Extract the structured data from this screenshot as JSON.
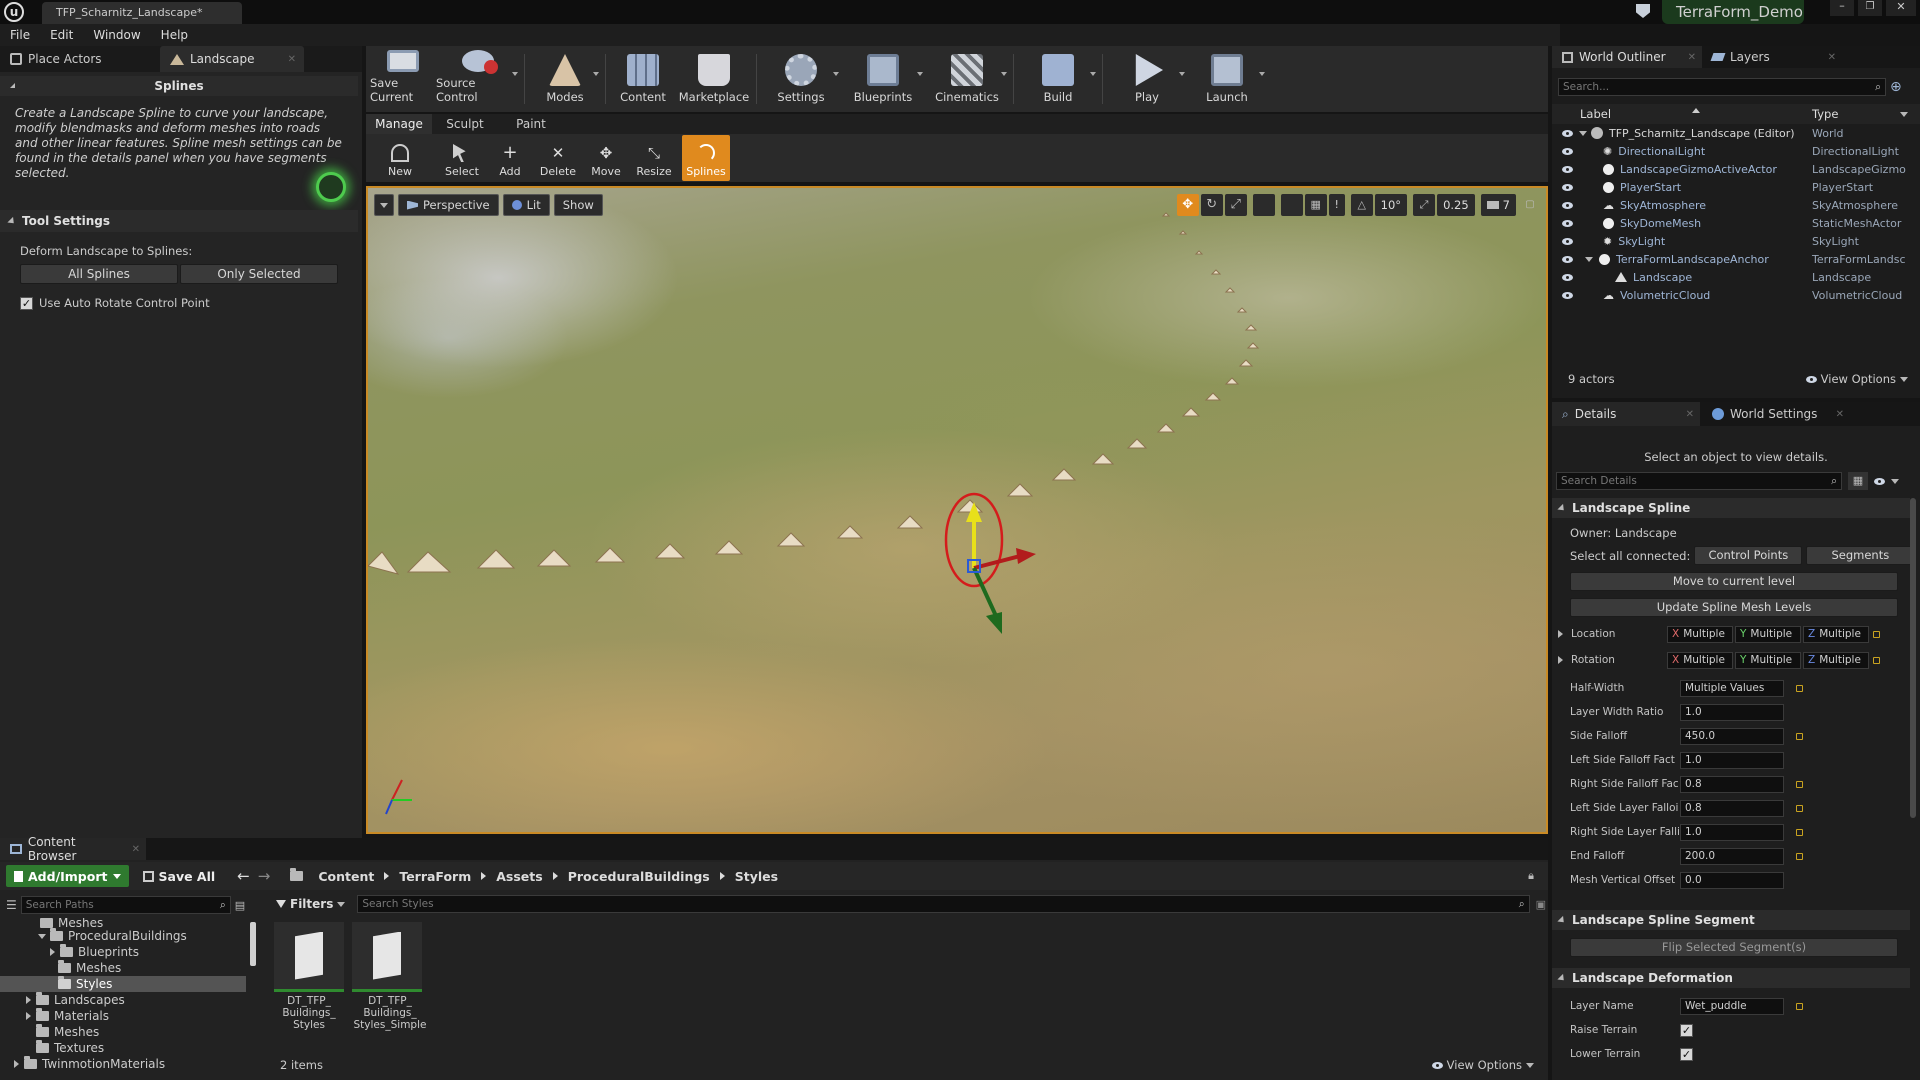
{
  "window": {
    "tab_title": "TFP_Scharnitz_Landscape*",
    "project_name": "TerraForm_Demo"
  },
  "menu": [
    "File",
    "Edit",
    "Window",
    "Help"
  ],
  "left_tabs": {
    "place_actors": "Place Actors",
    "landscape": "Landscape"
  },
  "splines_panel": {
    "title": "Splines",
    "description": "Create a Landscape Spline to curve your landscape, modify blendmasks and deform meshes into roads and other linear features.  Spline mesh settings can be found in the details panel when you have  segments selected.",
    "tool_settings_title": "Tool Settings",
    "deform_label": "Deform Landscape to Splines:",
    "all_splines": "All Splines",
    "only_selected": "Only Selected",
    "auto_rotate_label": "Use Auto Rotate Control Point",
    "auto_rotate_checked": true
  },
  "toolbar": [
    {
      "label": "Save Current",
      "icon": "save-icon"
    },
    {
      "label": "Source Control",
      "icon": "source-control-icon"
    },
    {
      "label": "Modes",
      "icon": "modes-icon"
    },
    {
      "label": "Content",
      "icon": "content-icon"
    },
    {
      "label": "Marketplace",
      "icon": "marketplace-icon"
    },
    {
      "label": "Settings",
      "icon": "settings-icon"
    },
    {
      "label": "Blueprints",
      "icon": "blueprints-icon"
    },
    {
      "label": "Cinematics",
      "icon": "cinematics-icon"
    },
    {
      "label": "Build",
      "icon": "build-icon"
    },
    {
      "label": "Play",
      "icon": "play-icon"
    },
    {
      "label": "Launch",
      "icon": "launch-icon"
    }
  ],
  "landscape_modes": {
    "manage": "Manage",
    "sculpt": "Sculpt",
    "paint": "Paint"
  },
  "manage_tools": [
    {
      "label": "New"
    },
    {
      "label": "Select"
    },
    {
      "label": "Add"
    },
    {
      "label": "Delete"
    },
    {
      "label": "Move"
    },
    {
      "label": "Resize"
    },
    {
      "label": "Splines"
    }
  ],
  "viewport": {
    "perspective": "Perspective",
    "lit": "Lit",
    "show": "Show",
    "rotation_snap": "10°",
    "scale_snap": "0.25",
    "camera_speed": "7"
  },
  "outliner": {
    "tab_outliner": "World Outliner",
    "tab_layers": "Layers",
    "search_placeholder": "Search...",
    "col_label": "Label",
    "col_type": "Type",
    "rows": [
      {
        "label": "TFP_Scharnitz_Landscape (Editor)",
        "type": "World"
      },
      {
        "label": "DirectionalLight",
        "type": "DirectionalLight"
      },
      {
        "label": "LandscapeGizmoActiveActor",
        "type": "LandscapeGizmo"
      },
      {
        "label": "PlayerStart",
        "type": "PlayerStart"
      },
      {
        "label": "SkyAtmosphere",
        "type": "SkyAtmosphere"
      },
      {
        "label": "SkyDomeMesh",
        "type": "StaticMeshActor"
      },
      {
        "label": "SkyLight",
        "type": "SkyLight"
      },
      {
        "label": "TerraFormLandscapeAnchor",
        "type": "TerraFormLandsc"
      },
      {
        "label": "Landscape",
        "type": "Landscape"
      },
      {
        "label": "VolumetricCloud",
        "type": "VolumetricCloud"
      }
    ],
    "count": "9 actors",
    "view_options": "View Options"
  },
  "details": {
    "tab_details": "Details",
    "tab_world_settings": "World Settings",
    "hint": "Select an object to view details.",
    "search_placeholder": "Search Details",
    "spline_section": "Landscape Spline",
    "owner": "Owner: Landscape",
    "select_all_connected": "Select all connected:",
    "control_points": "Control Points",
    "segments": "Segments",
    "move_to_level": "Move to current level",
    "update_mesh_levels": "Update Spline Mesh Levels",
    "location_label": "Location",
    "rotation_label": "Rotation",
    "multiple": "Multiple",
    "x": "X",
    "y": "Y",
    "z": "Z",
    "props": [
      {
        "label": "Half-Width",
        "value": "Multiple Values"
      },
      {
        "label": "Layer Width Ratio",
        "value": "1.0"
      },
      {
        "label": "Side Falloff",
        "value": "450.0"
      },
      {
        "label": "Left Side Falloff Fact",
        "value": "1.0"
      },
      {
        "label": "Right Side Falloff Fac",
        "value": "0.8"
      },
      {
        "label": "Left Side Layer Falloi",
        "value": "0.8"
      },
      {
        "label": "Right Side Layer Falli",
        "value": "1.0"
      },
      {
        "label": "End Falloff",
        "value": "200.0"
      },
      {
        "label": "Mesh Vertical Offset",
        "value": "0.0"
      }
    ],
    "segment_section": "Landscape Spline Segment",
    "flip_segments": "Flip Selected Segment(s)",
    "deformation_section": "Landscape Deformation",
    "layer_name_label": "Layer Name",
    "layer_name_value": "Wet_puddle",
    "raise_terrain": "Raise Terrain",
    "lower_terrain": "Lower Terrain"
  },
  "content_browser": {
    "tab": "Content Browser",
    "add_import": "Add/Import",
    "save_all": "Save All",
    "path": [
      "Content",
      "TerraForm",
      "Assets",
      "ProceduralBuildings",
      "Styles"
    ],
    "search_paths": "Search Paths",
    "filters": "Filters",
    "search_styles": "Search Styles",
    "tree": [
      {
        "label": "Meshes",
        "level": 2
      },
      {
        "label": "ProceduralBuildings",
        "level": 2
      },
      {
        "label": "Blueprints",
        "level": 3
      },
      {
        "label": "Meshes",
        "level": 3
      },
      {
        "label": "Styles",
        "level": 3
      },
      {
        "label": "Landscapes",
        "level": 1
      },
      {
        "label": "Materials",
        "level": 1
      },
      {
        "label": "Meshes",
        "level": 1
      },
      {
        "label": "Textures",
        "level": 1
      },
      {
        "label": "TwinmotionMaterials",
        "level": 0
      }
    ],
    "assets": [
      {
        "label": "DT_TFP_ Buildings_ Styles"
      },
      {
        "label": "DT_TFP_ Buildings_ Styles_Simple"
      }
    ],
    "item_count": "2 items",
    "view_options": "View Options"
  }
}
